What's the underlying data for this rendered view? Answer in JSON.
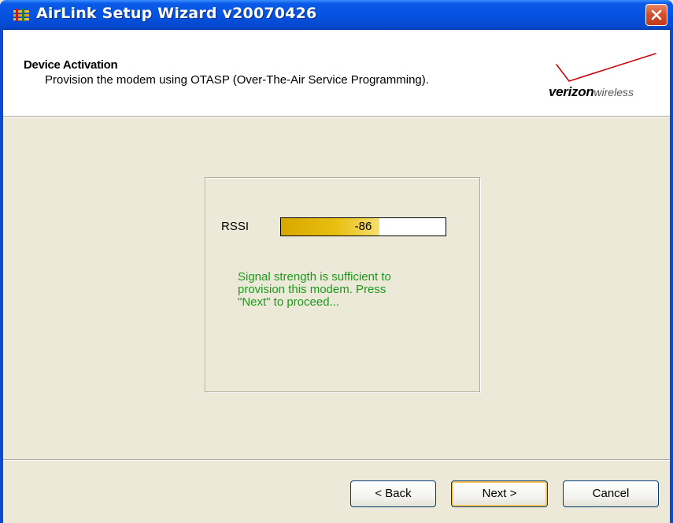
{
  "window": {
    "title": "AirLink Setup Wizard v20070426"
  },
  "header": {
    "title": "Device Activation",
    "description": "Provision the modem using OTASP (Over-The-Air Service Programming).",
    "logo_text_bold": "verizon",
    "logo_text_light": "wireless"
  },
  "signal": {
    "label": "RSSI",
    "value": "-86",
    "fill_fraction": 0.6,
    "message": "Signal strength is sufficient to\nprovision this modem.  Press\n\"Next\" to proceed..."
  },
  "buttons": {
    "back": "< Back",
    "next": "Next >",
    "cancel": "Cancel"
  },
  "colors": {
    "titlebar": "#0553e0",
    "status_text": "#1a9a1a",
    "signal_fill": "#e8be10",
    "logo_red": "#cd040b"
  },
  "icons": {
    "app": "airlink-app-icon",
    "close": "close-icon",
    "logo_check": "verizon-check-icon"
  }
}
